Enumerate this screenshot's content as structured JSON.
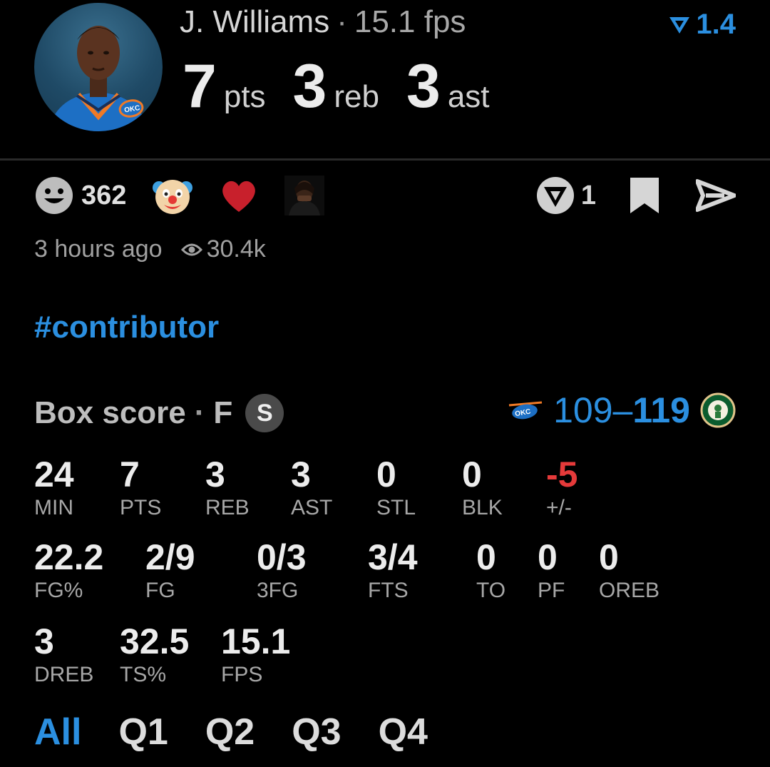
{
  "header": {
    "player_name": "J. Williams",
    "separator": "·",
    "fps": "15.1 fps",
    "rating": "1.4",
    "accent_color": "#2b8fe0"
  },
  "statline": [
    {
      "value": "7",
      "label": "pts"
    },
    {
      "value": "3",
      "label": "reb"
    },
    {
      "value": "3",
      "label": "ast"
    }
  ],
  "reactions": {
    "smile_count": "362",
    "emojis": [
      "clown-emoji",
      "heart-emoji",
      "reaction-gif"
    ],
    "rate_count": "1"
  },
  "meta": {
    "time": "3 hours ago",
    "views": "30.4k"
  },
  "hashtag": "#contributor",
  "box_score": {
    "title": "Box score",
    "separator": "·",
    "status": "F",
    "badge": "S",
    "score_home": "109",
    "score_dash": "–",
    "score_away": "119",
    "teams": [
      "okc-logo",
      "celtics-logo"
    ]
  },
  "stats_row1": [
    {
      "value": "24",
      "label": "MIN"
    },
    {
      "value": "7",
      "label": "PTS"
    },
    {
      "value": "3",
      "label": "REB"
    },
    {
      "value": "3",
      "label": "AST"
    },
    {
      "value": "0",
      "label": "STL"
    },
    {
      "value": "0",
      "label": "BLK"
    },
    {
      "value": "-5",
      "label": "+/-"
    }
  ],
  "stats_row2": [
    {
      "value": "22.2",
      "label": "FG%"
    },
    {
      "value": "2/9",
      "label": "FG"
    },
    {
      "value": "0/3",
      "label": "3FG"
    },
    {
      "value": "3/4",
      "label": "FTS"
    },
    {
      "value": "0",
      "label": "TO"
    },
    {
      "value": "0",
      "label": "PF"
    },
    {
      "value": "0",
      "label": "OREB"
    }
  ],
  "stats_row3": [
    {
      "value": "3",
      "label": "DREB"
    },
    {
      "value": "32.5",
      "label": "TS%"
    },
    {
      "value": "15.1",
      "label": "FPS"
    }
  ],
  "tabs": [
    {
      "label": "All",
      "active": true
    },
    {
      "label": "Q1"
    },
    {
      "label": "Q2"
    },
    {
      "label": "Q3"
    },
    {
      "label": "Q4"
    }
  ]
}
